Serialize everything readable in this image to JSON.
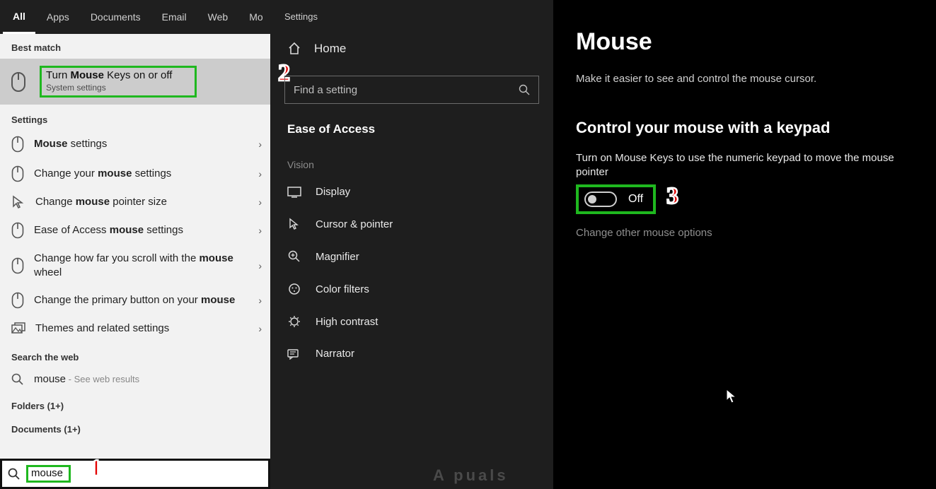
{
  "tabs": {
    "all": "All",
    "apps": "Apps",
    "documents": "Documents",
    "email": "Email",
    "web": "Web",
    "more": "Mo"
  },
  "best_match_header": "Best match",
  "best_match": {
    "title_pre": "Turn ",
    "title_bold": "Mouse",
    "title_post": " Keys on or off",
    "subtitle": "System settings"
  },
  "settings_header": "Settings",
  "settings_items": [
    {
      "pre": "",
      "bold": "Mouse",
      "post": " settings"
    },
    {
      "pre": "Change your ",
      "bold": "mouse",
      "post": " settings"
    },
    {
      "pre": "Change ",
      "bold": "mouse",
      "post": " pointer size"
    },
    {
      "pre": "Ease of Access ",
      "bold": "mouse",
      "post": " settings"
    },
    {
      "pre": "Change how far you scroll with the ",
      "bold": "mouse",
      "post": " wheel"
    },
    {
      "pre": "Change the primary button on your ",
      "bold": "mouse",
      "post": ""
    },
    {
      "pre": "Themes and related settings",
      "bold": "",
      "post": ""
    }
  ],
  "web_header": "Search the web",
  "web_item": {
    "term": "mouse",
    "hint": " - See web results"
  },
  "folders": "Folders (1+)",
  "documents": "Documents (1+)",
  "search_value": "mouse",
  "nav": {
    "window": "Settings",
    "home": "Home",
    "find_placeholder": "Find a setting",
    "eoa": "Ease of Access",
    "group_vision": "Vision",
    "items": [
      {
        "label": "Display"
      },
      {
        "label": "Cursor & pointer"
      },
      {
        "label": "Magnifier"
      },
      {
        "label": "Color filters"
      },
      {
        "label": "High contrast"
      },
      {
        "label": "Narrator"
      }
    ]
  },
  "page": {
    "title": "Mouse",
    "desc": "Make it easier to see and control the mouse cursor.",
    "h2": "Control your mouse with a keypad",
    "text": "Turn on Mouse Keys to use the numeric keypad to move the mouse pointer",
    "toggle_state": "Off",
    "link": "Change other mouse options"
  },
  "badges": {
    "one": "1",
    "two": "2",
    "three": "3"
  },
  "watermark": "A  puals"
}
